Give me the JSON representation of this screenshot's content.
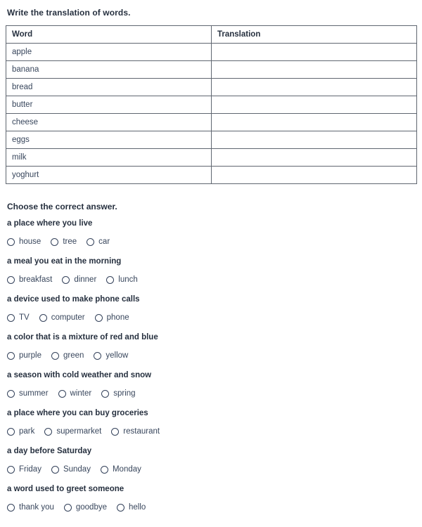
{
  "worksheet": {
    "translation_section": {
      "title": "Write the translation of words.",
      "columns": [
        "Word",
        "Translation"
      ],
      "rows": [
        {
          "word": "apple",
          "translation": ""
        },
        {
          "word": "banana",
          "translation": ""
        },
        {
          "word": "bread",
          "translation": ""
        },
        {
          "word": "butter",
          "translation": ""
        },
        {
          "word": "cheese",
          "translation": ""
        },
        {
          "word": "eggs",
          "translation": ""
        },
        {
          "word": "milk",
          "translation": ""
        },
        {
          "word": "yoghurt",
          "translation": ""
        }
      ]
    },
    "quiz_section": {
      "title": "Choose the correct answer.",
      "questions": [
        {
          "prompt": "a place where you live",
          "options": [
            "house",
            "tree",
            "car"
          ]
        },
        {
          "prompt": "a meal you eat in the morning",
          "options": [
            "breakfast",
            "dinner",
            "lunch"
          ]
        },
        {
          "prompt": "a device used to make phone calls",
          "options": [
            "TV",
            "computer",
            "phone"
          ]
        },
        {
          "prompt": "a color that is a mixture of red and blue",
          "options": [
            "purple",
            "green",
            "yellow"
          ]
        },
        {
          "prompt": "a season with cold weather and snow",
          "options": [
            "summer",
            "winter",
            "spring"
          ]
        },
        {
          "prompt": "a place where you can buy groceries",
          "options": [
            "park",
            "supermarket",
            "restaurant"
          ]
        },
        {
          "prompt": "a day before Saturday",
          "options": [
            "Friday",
            "Sunday",
            "Monday"
          ]
        },
        {
          "prompt": "a word used to greet someone",
          "options": [
            "thank you",
            "goodbye",
            "hello"
          ]
        }
      ]
    }
  },
  "colors": {
    "heading": "#26303f",
    "body_text": "#38465c",
    "table_border": "#5f6670",
    "radio_stroke": "#33415a",
    "background": "#ffffff"
  }
}
